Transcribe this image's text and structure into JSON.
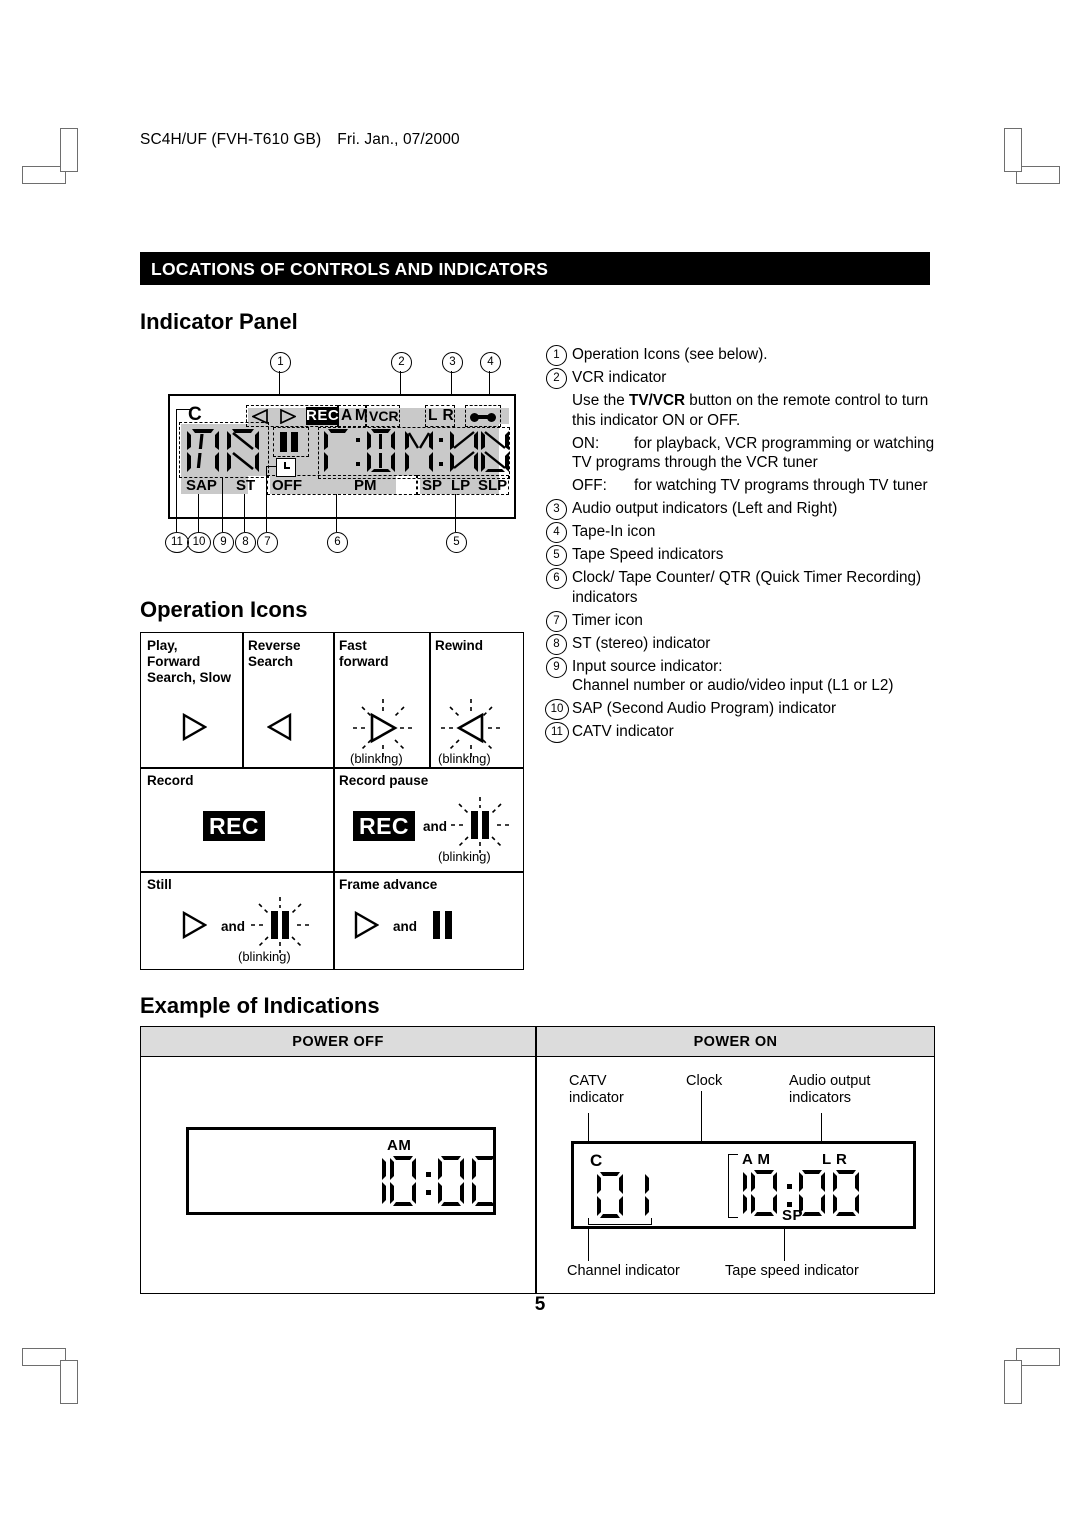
{
  "page": {
    "header": "SC4H/UF (FVH-T610 GB)",
    "header_date": "Fri. Jan., 07/2000",
    "banner_title": "LOCATIONS OF CONTROLS AND INDICATORS",
    "number": "5"
  },
  "sections": {
    "indicator_panel": "Indicator Panel",
    "operation_icons": "Operation Icons",
    "example_of_indications": "Example of Indications"
  },
  "panel": {
    "top_labels": {
      "c": "C",
      "rec": "REC",
      "am": "A M",
      "vcr": "VCR",
      "lr": "L R"
    },
    "bottom_labels": {
      "sap": "SAP",
      "st": "ST",
      "off": "OFF",
      "pm": "PM",
      "sp": "SP",
      "lp": "LP",
      "slp": "SLP"
    },
    "callouts": [
      "1",
      "2",
      "3",
      "4",
      "5",
      "6",
      "7",
      "8",
      "9",
      "10",
      "11"
    ]
  },
  "legend": [
    {
      "num": "1",
      "text": "Operation Icons (see below)."
    },
    {
      "num": "2",
      "text": "VCR indicator"
    },
    {
      "num": "3",
      "text": "Audio output indicators (Left and Right)"
    },
    {
      "num": "4",
      "text": "Tape-In icon"
    },
    {
      "num": "5",
      "text": "Tape Speed indicators"
    },
    {
      "num": "6",
      "text": "Clock/ Tape Counter/ QTR (Quick Timer Recording) indicators"
    },
    {
      "num": "7",
      "text": "Timer icon"
    },
    {
      "num": "8",
      "text": "ST (stereo) indicator"
    },
    {
      "num": "9",
      "text": "Input source indicator:"
    },
    {
      "num": "10",
      "text": "SAP (Second Audio Program) indicator"
    },
    {
      "num": "11",
      "text": "CATV indicator"
    }
  ],
  "legend_detail": {
    "vcr_use_pre": "Use the ",
    "vcr_use_bold": "TV/VCR",
    "vcr_use_post": " button on the remote control to turn this indicator ON or OFF.",
    "on_key": "ON:",
    "on_text": "for playback, VCR programming or watching TV programs through the VCR tuner",
    "off_key": "OFF:",
    "off_text": "for watching TV programs through TV tuner",
    "input_source_line2": "Channel number or audio/video input (L1 or L2)"
  },
  "operation_icons": {
    "cells": [
      {
        "title": "Play,\nForward\nSearch, Slow",
        "icon": "play-triangle",
        "note": ""
      },
      {
        "title": "Reverse\nSearch",
        "icon": "reverse-triangle",
        "note": ""
      },
      {
        "title": "Fast\nforward",
        "icon": "play-triangle-blinking",
        "note": "(blinking)"
      },
      {
        "title": "Rewind",
        "icon": "reverse-triangle-blinking",
        "note": "(blinking)"
      },
      {
        "title": "Record",
        "icon": "rec-badge",
        "note": ""
      },
      {
        "title": "Record pause",
        "icon": "rec-badge-and-pause-blinking",
        "note": "(blinking)"
      },
      {
        "title": "Still",
        "icon": "play-and-pause-blinking",
        "note": "(blinking)"
      },
      {
        "title": "Frame advance",
        "icon": "play-and-pause",
        "note": ""
      }
    ],
    "and_word": "and",
    "rec_label": "REC",
    "blinking_label": "(blinking)"
  },
  "example": {
    "col_power_off": "POWER OFF",
    "col_power_on": "POWER ON",
    "power_off_display": {
      "meridiem": "AM",
      "time": "10:00"
    },
    "power_on_display": {
      "catv": "C",
      "channel": "01",
      "meridiem": "A M",
      "time": "10:00",
      "audio": "L R",
      "speed": "SP"
    },
    "annotations": {
      "catv": "CATV\nindicator",
      "clock": "Clock",
      "audio": "Audio output\nindicators",
      "channel": "Channel indicator",
      "speed": "Tape speed indicator"
    }
  }
}
